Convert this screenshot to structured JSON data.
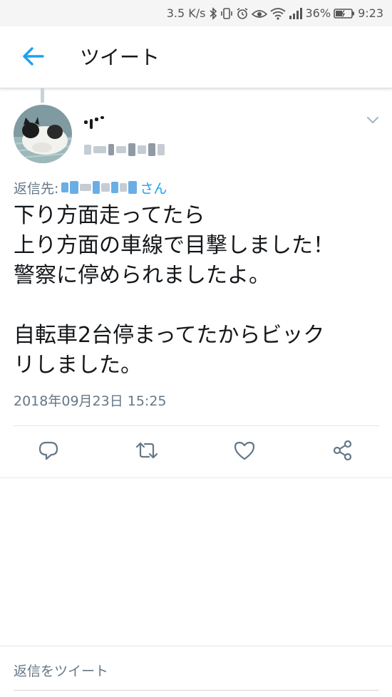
{
  "status_bar": {
    "speed": "3.5 K/s",
    "battery_percent": "36%",
    "time": "9:23"
  },
  "header": {
    "title": "ツイート"
  },
  "tweet": {
    "reply_to_label": "返信先:",
    "reply_to_suffix": "さん",
    "text": "下り方面走ってたら\n上り方面の車線で目撃しました！\n警察に停められましたよ。\n\n自転車2台停まってたからビック\nリしました。",
    "timestamp": "2018年09月23日 15:25"
  },
  "reply_bar": {
    "placeholder": "返信をツイート"
  },
  "colors": {
    "accent": "#1da1f2",
    "secondary_text": "#657786",
    "icon": "#657786",
    "divider": "#e1e8ed"
  },
  "icons": {
    "back": "arrow-left-icon",
    "caret": "chevron-down-icon",
    "reply": "reply-icon",
    "retweet": "retweet-icon",
    "like": "heart-icon",
    "share": "share-icon"
  }
}
